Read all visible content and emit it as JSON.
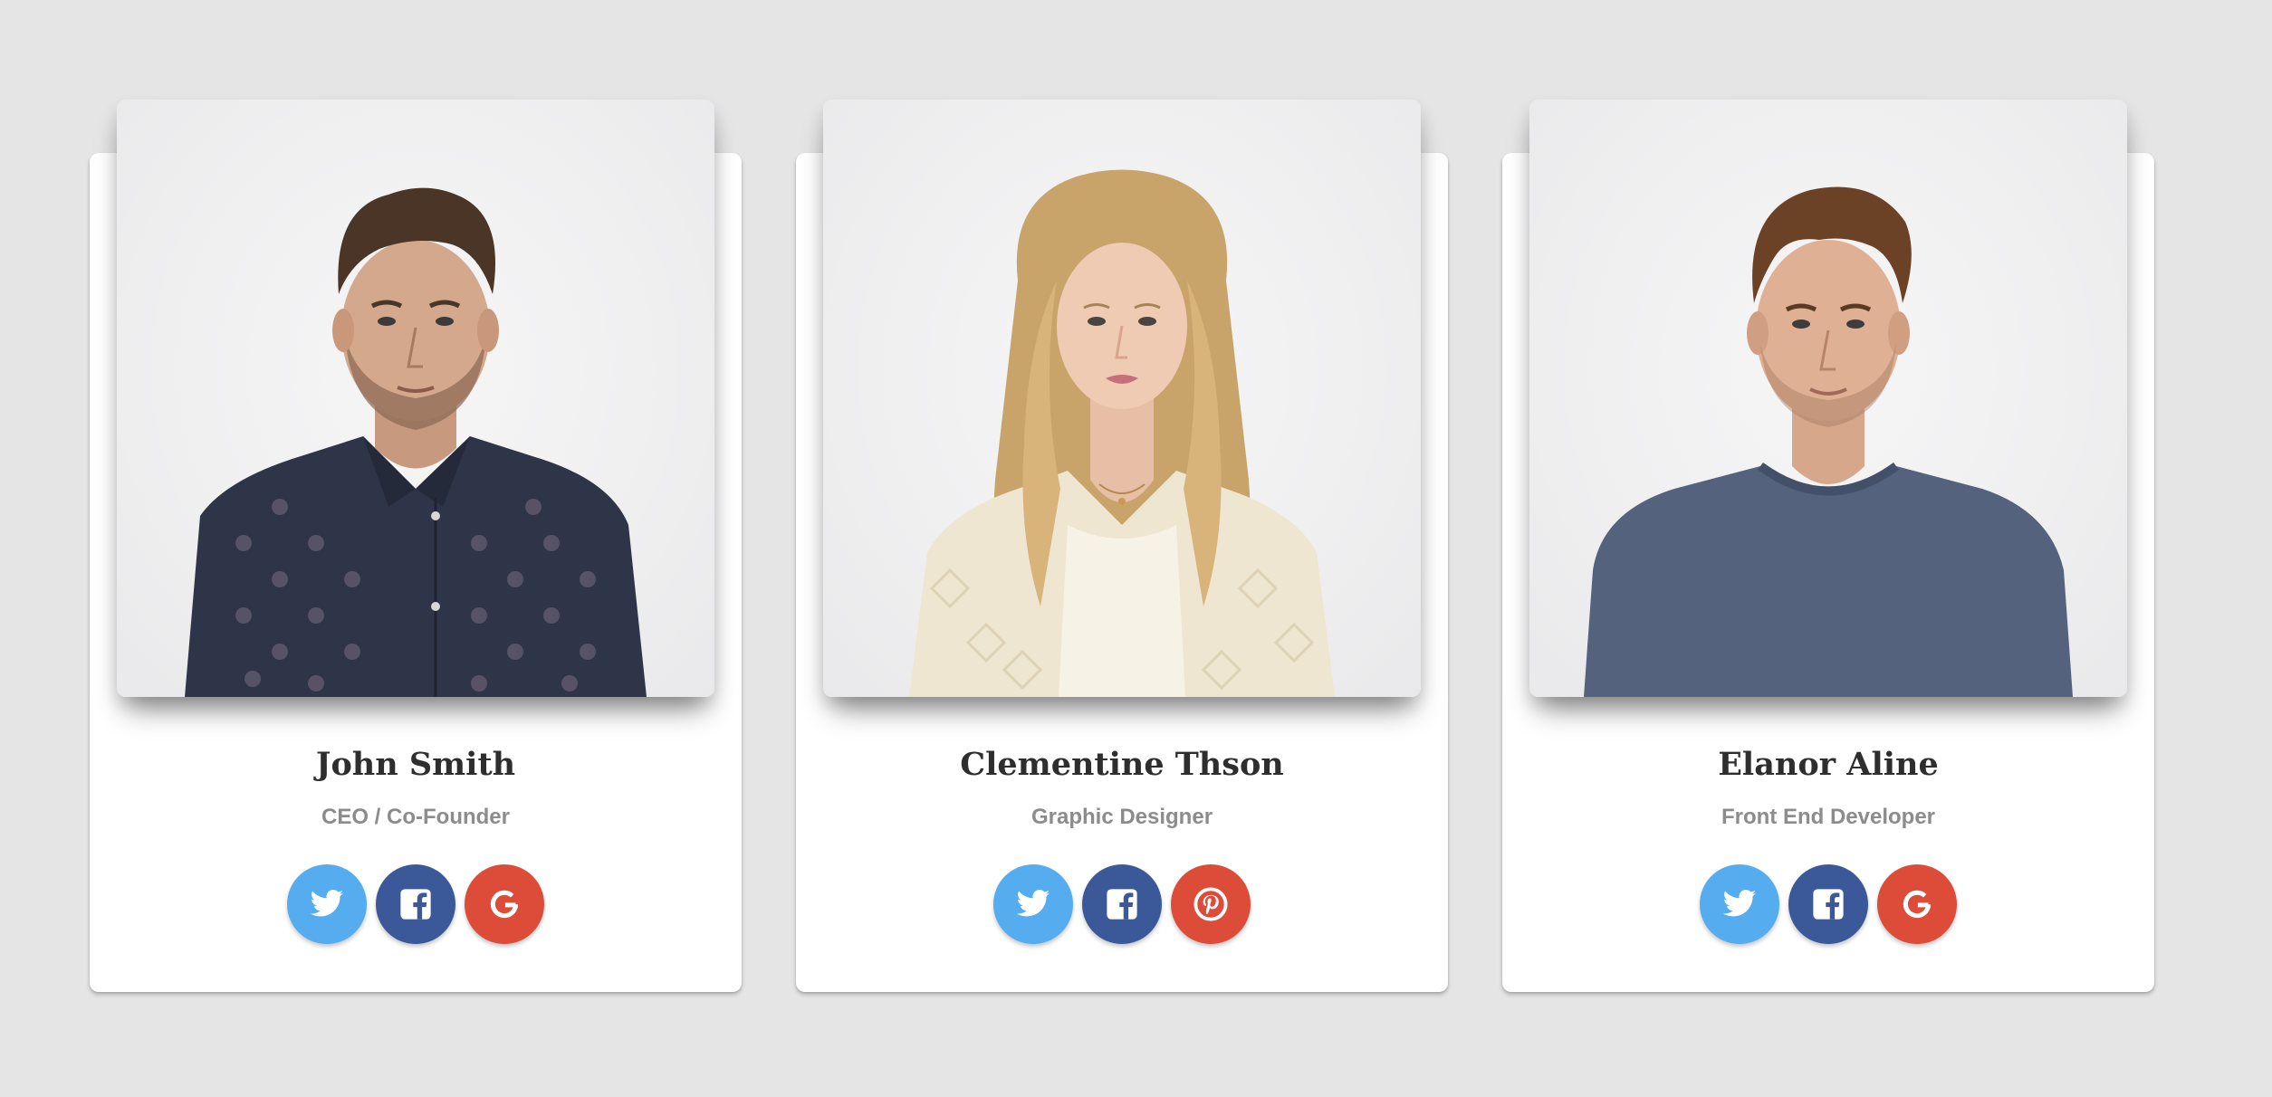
{
  "members": [
    {
      "name": "John Smith",
      "role": "CEO / Co-Founder",
      "photo_icon": "man-portrait-patterned-shirt",
      "socials": [
        "twitter-icon",
        "facebook-icon",
        "google-icon"
      ]
    },
    {
      "name": "Clementine Thson",
      "role": "Graphic Designer",
      "photo_icon": "woman-portrait-blonde-cardigan",
      "socials": [
        "twitter-icon",
        "facebook-icon",
        "pinterest-icon"
      ]
    },
    {
      "name": "Elanor Aline",
      "role": "Front End Developer",
      "photo_icon": "man-portrait-grey-tshirt",
      "socials": [
        "twitter-icon",
        "facebook-icon",
        "google-icon"
      ]
    }
  ],
  "colors": {
    "background": "#e5e5e5",
    "card": "#ffffff",
    "twitter": "#55acee",
    "facebook": "#3b5998",
    "google": "#dd4b39",
    "pinterest": "#dd4b39",
    "name_text": "#2e2e2e",
    "role_text": "#8c8c8c"
  }
}
